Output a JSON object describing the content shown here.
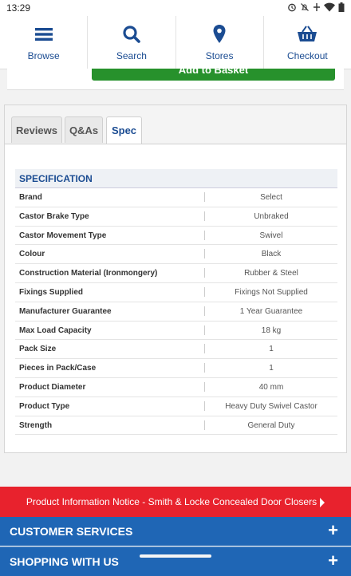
{
  "status_bar": {
    "time": "13:29"
  },
  "nav": {
    "items": [
      {
        "label": "Browse",
        "icon": "menu-icon"
      },
      {
        "label": "Search",
        "icon": "search-icon"
      },
      {
        "label": "Stores",
        "icon": "location-pin-icon"
      },
      {
        "label": "Checkout",
        "icon": "basket-icon"
      }
    ]
  },
  "basket": {
    "label": "Add to Basket"
  },
  "tabs": [
    {
      "label": "Reviews",
      "active": false
    },
    {
      "label": "Q&As",
      "active": false
    },
    {
      "label": "Spec",
      "active": true
    }
  ],
  "spec": {
    "title": "SPECIFICATION",
    "rows": [
      {
        "name": "Brand",
        "value": "Select"
      },
      {
        "name": "Castor Brake Type",
        "value": "Unbraked"
      },
      {
        "name": "Castor Movement Type",
        "value": "Swivel"
      },
      {
        "name": "Colour",
        "value": "Black"
      },
      {
        "name": "Construction Material (Ironmongery)",
        "value": "Rubber & Steel"
      },
      {
        "name": "Fixings Supplied",
        "value": "Fixings Not Supplied"
      },
      {
        "name": "Manufacturer Guarantee",
        "value": "1 Year Guarantee"
      },
      {
        "name": "Max Load Capacity",
        "value": "18 kg"
      },
      {
        "name": "Pack Size",
        "value": "1"
      },
      {
        "name": "Pieces in Pack/Case",
        "value": "1"
      },
      {
        "name": "Product Diameter",
        "value": "40 mm"
      },
      {
        "name": "Product Type",
        "value": "Heavy Duty Swivel Castor"
      },
      {
        "name": "Strength",
        "value": "General Duty"
      }
    ]
  },
  "notice": {
    "text": "Product Information Notice - Smith & Locke Concealed Door Closers"
  },
  "footer": {
    "sections": [
      {
        "label": "CUSTOMER SERVICES"
      },
      {
        "label": "SHOPPING WITH US"
      }
    ]
  },
  "colors": {
    "brand_blue": "#1b4c92",
    "basket_green": "#27912c",
    "notice_red": "#e8222d",
    "footer_blue": "#1f66b5"
  }
}
